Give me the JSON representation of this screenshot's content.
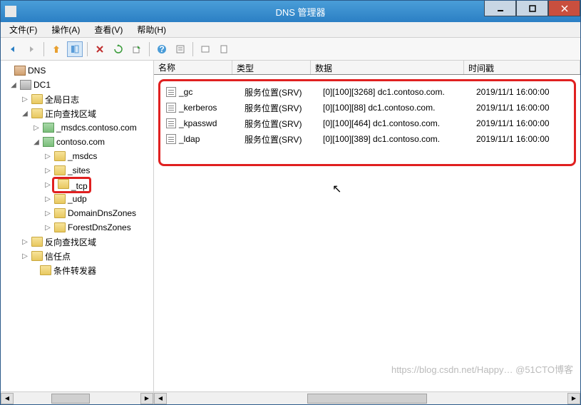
{
  "window": {
    "title": "DNS 管理器"
  },
  "menu": {
    "file": "文件(F)",
    "action": "操作(A)",
    "view": "查看(V)",
    "help": "帮助(H)"
  },
  "tree": {
    "root": "DNS",
    "server": "DC1",
    "global_log": "全局日志",
    "fwd_zone": "正向查找区域",
    "msdcs_zone": "_msdcs.contoso.com",
    "contoso": "contoso.com",
    "msdcs": "_msdcs",
    "sites": "_sites",
    "tcp": "_tcp",
    "udp": "_udp",
    "domain_dns": "DomainDnsZones",
    "forest_dns": "ForestDnsZones",
    "rev_zone": "反向查找区域",
    "trust": "信任点",
    "cond_fwd": "条件转发器"
  },
  "columns": {
    "name": "名称",
    "type": "类型",
    "data": "数据",
    "timestamp": "时间戳"
  },
  "records": [
    {
      "name": "_gc",
      "type": "服务位置(SRV)",
      "data": "[0][100][3268] dc1.contoso.com.",
      "time": "2019/11/1 16:00:00"
    },
    {
      "name": "_kerberos",
      "type": "服务位置(SRV)",
      "data": "[0][100][88] dc1.contoso.com.",
      "time": "2019/11/1 16:00:00"
    },
    {
      "name": "_kpasswd",
      "type": "服务位置(SRV)",
      "data": "[0][100][464] dc1.contoso.com.",
      "time": "2019/11/1 16:00:00"
    },
    {
      "name": "_ldap",
      "type": "服务位置(SRV)",
      "data": "[0][100][389] dc1.contoso.com.",
      "time": "2019/11/1 16:00:00"
    }
  ],
  "watermark": "https://blog.csdn.net/Happy…  @51CTO博客"
}
